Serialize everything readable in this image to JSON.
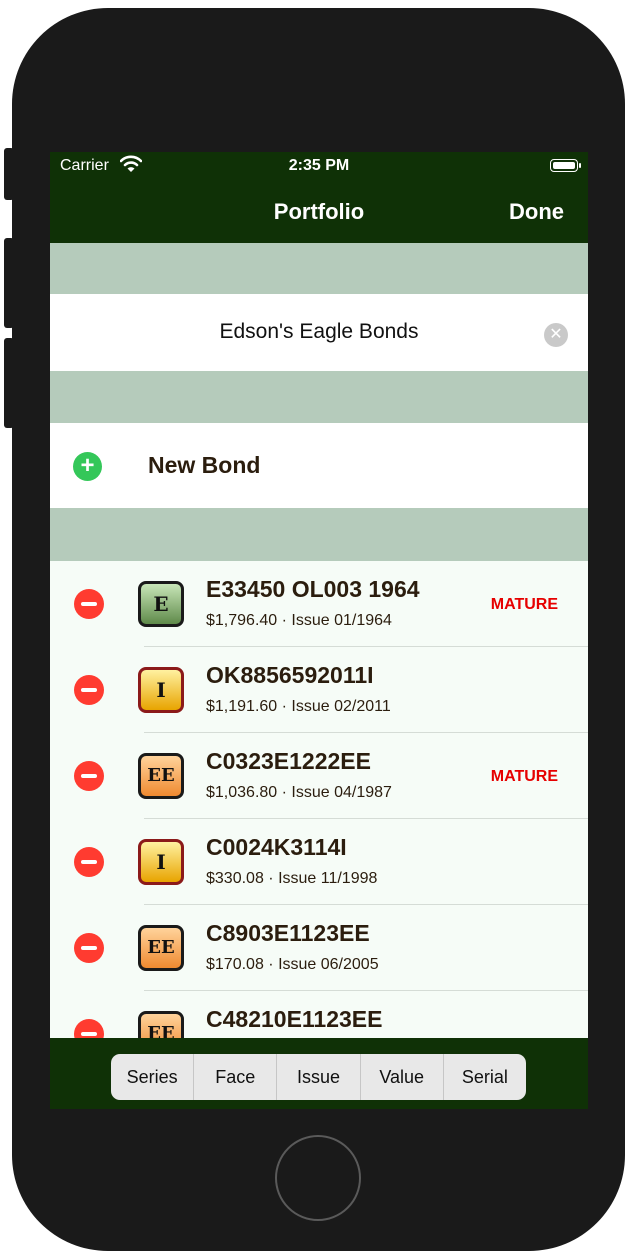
{
  "status_bar": {
    "carrier": "Carrier",
    "time": "2:35 PM"
  },
  "nav": {
    "title": "Portfolio",
    "done_label": "Done"
  },
  "portfolio_name": "Edson's Eagle Bonds",
  "new_bond_label": "New Bond",
  "bonds": [
    {
      "series": "E",
      "serial": "E33450 OL003 1964",
      "value": "$1,796.40",
      "issue": "Issue 01/1964",
      "status": "MATURE"
    },
    {
      "series": "I",
      "serial": "OK8856592011I",
      "value": "$1,191.60",
      "issue": "Issue 02/2011",
      "status": ""
    },
    {
      "series": "EE",
      "serial": "C0323E1222EE",
      "value": "$1,036.80",
      "issue": "Issue 04/1987",
      "status": "MATURE"
    },
    {
      "series": "I",
      "serial": "C0024K3114I",
      "value": "$330.08",
      "issue": "Issue 11/1998",
      "status": ""
    },
    {
      "series": "EE",
      "serial": "C8903E1123EE",
      "value": "$170.08",
      "issue": "Issue 06/2005",
      "status": ""
    },
    {
      "series": "EE",
      "serial": "C48210E1123EE",
      "value": "",
      "issue": "",
      "status": ""
    }
  ],
  "sort_options": [
    "Series",
    "Face",
    "Issue",
    "Value",
    "Serial"
  ],
  "colors": {
    "nav_background": "#0f3106",
    "section_background": "#b5cbbb",
    "mature": "#e60000",
    "delete": "#ff3b30",
    "add": "#34c759"
  },
  "icons": {
    "wifi": "wifi-icon",
    "battery": "battery-icon",
    "clear": "clear-icon",
    "add": "add-icon",
    "delete": "delete-icon"
  }
}
